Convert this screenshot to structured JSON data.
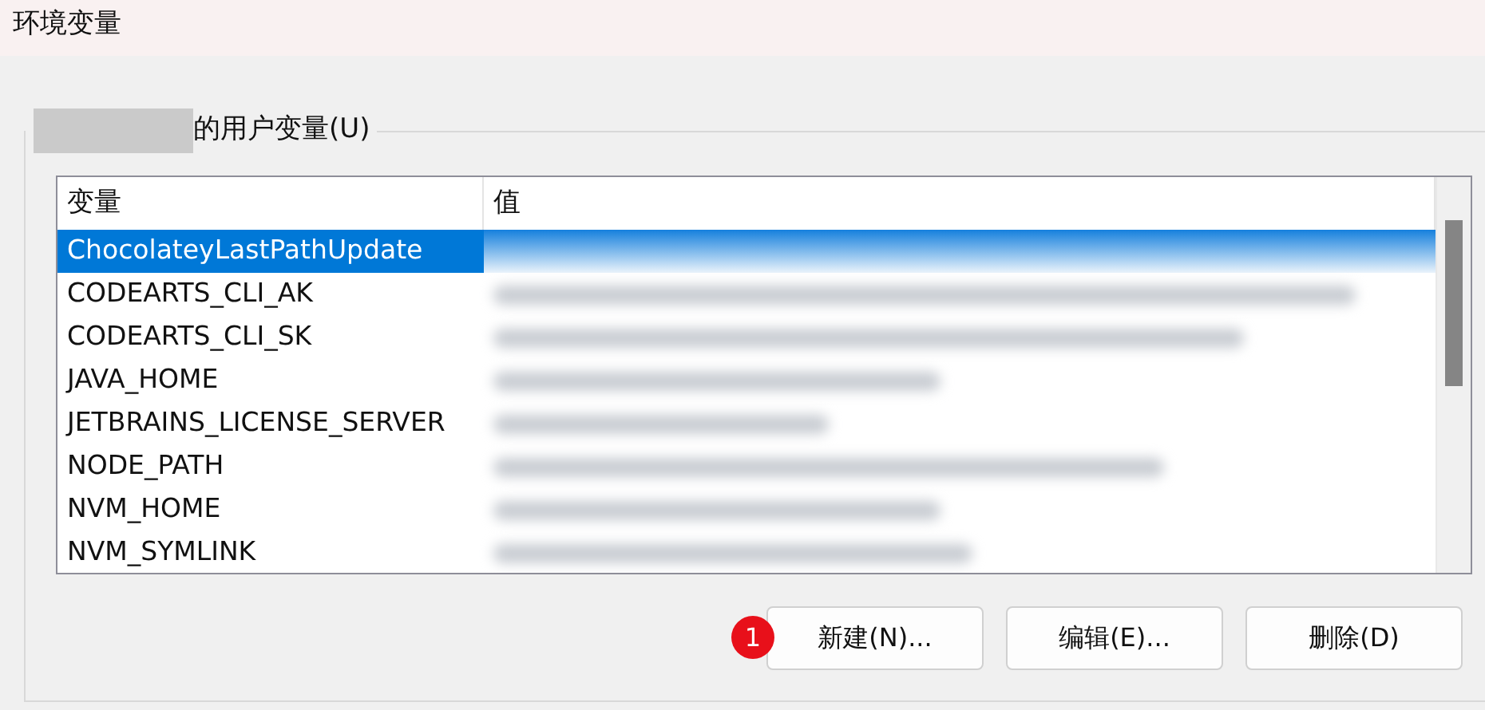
{
  "window": {
    "title": "环境变量"
  },
  "group": {
    "label": "的用户变量(U)"
  },
  "table": {
    "columns": [
      "变量",
      "值"
    ],
    "rows": [
      {
        "name": "ChocolateyLastPathUpdate",
        "selected": true
      },
      {
        "name": "CODEARTS_CLI_AK",
        "selected": false
      },
      {
        "name": "CODEARTS_CLI_SK",
        "selected": false
      },
      {
        "name": "JAVA_HOME",
        "selected": false
      },
      {
        "name": "JETBRAINS_LICENSE_SERVER",
        "selected": false
      },
      {
        "name": "NODE_PATH",
        "selected": false
      },
      {
        "name": "NVM_HOME",
        "selected": false
      },
      {
        "name": "NVM_SYMLINK",
        "selected": false
      }
    ]
  },
  "buttons": [
    {
      "label": "新建(N)...",
      "badge": "1"
    },
    {
      "label": "编辑(E)..."
    },
    {
      "label": "删除(D)"
    }
  ]
}
